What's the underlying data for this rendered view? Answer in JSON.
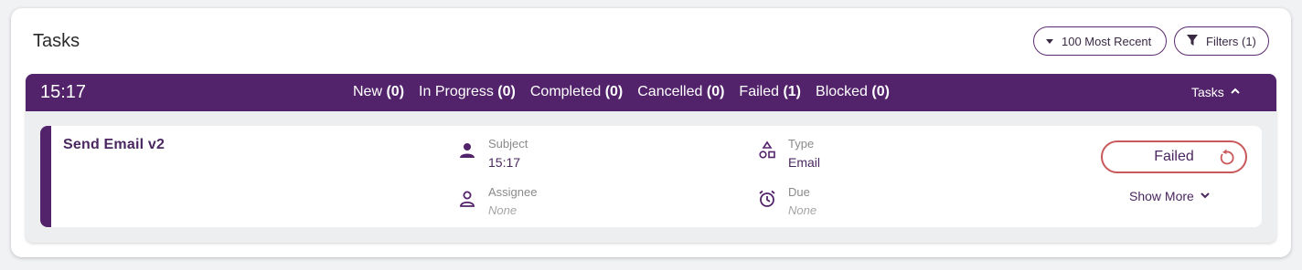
{
  "card": {
    "title": "Tasks"
  },
  "controls": {
    "recent_label": "100 Most Recent",
    "filters_label": "Filters (1)"
  },
  "task_bar": {
    "time": "15:17",
    "statuses": [
      {
        "label": "New",
        "count": "(0)"
      },
      {
        "label": "In Progress",
        "count": "(0)"
      },
      {
        "label": "Completed",
        "count": "(0)"
      },
      {
        "label": "Cancelled",
        "count": "(0)"
      },
      {
        "label": "Failed",
        "count": "(1)"
      },
      {
        "label": "Blocked",
        "count": "(0)"
      }
    ],
    "toggle_label": "Tasks"
  },
  "task": {
    "name": "Send Email v2",
    "subject_label": "Subject",
    "subject_value": "15:17",
    "assignee_label": "Assignee",
    "assignee_value": "None",
    "type_label": "Type",
    "type_value": "Email",
    "due_label": "Due",
    "due_value": "None",
    "status": "Failed",
    "show_more_label": "Show More"
  },
  "colors": {
    "brand": "#52236b",
    "failed_border": "#c9585a",
    "text_primary": "#4a2760"
  },
  "icons": [
    "caret-down-icon",
    "filter-icon",
    "chevron-up-icon",
    "person-icon",
    "person-outline-icon",
    "shapes-icon",
    "alarm-icon",
    "retry-icon",
    "chevron-down-icon"
  ]
}
